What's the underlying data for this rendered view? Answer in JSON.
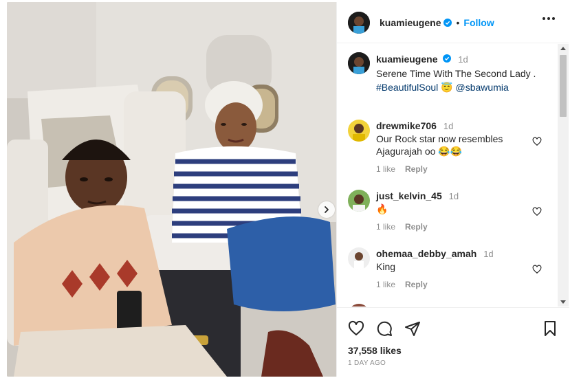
{
  "post": {
    "author": "kuamieugene",
    "follow_label": "Follow",
    "separator": "•",
    "more_icon": "more-horizontal-icon",
    "caption": {
      "time": "1d",
      "line1": "Serene Time With The Second Lady .",
      "hashtag": "#BeautifulSoul",
      "emoji": "😇",
      "mention": "@sbawumia"
    },
    "likes": "37,558 likes",
    "date": "1 DAY AGO"
  },
  "comments": [
    {
      "user": "drewmike706",
      "time": "1d",
      "text": "Our Rock star now resembles Ajagurajah oo 😂😂",
      "likes": "1 like",
      "reply": "Reply"
    },
    {
      "user": "just_kelvin_45",
      "time": "1d",
      "text": "🔥",
      "likes": "1 like",
      "reply": "Reply"
    },
    {
      "user": "ohemaa_debby_amah",
      "time": "1d",
      "text": "King",
      "likes": "1 like",
      "reply": "Reply"
    }
  ],
  "icons": {
    "like": "heart-icon",
    "comment": "comment-icon",
    "share": "paper-plane-icon",
    "save": "bookmark-icon",
    "next": "chevron-right-icon",
    "verified": "verified-badge-icon"
  },
  "colors": {
    "accent": "#0095f6",
    "text": "#262626",
    "muted": "#8e8e8e",
    "verified": "#0095f6"
  }
}
